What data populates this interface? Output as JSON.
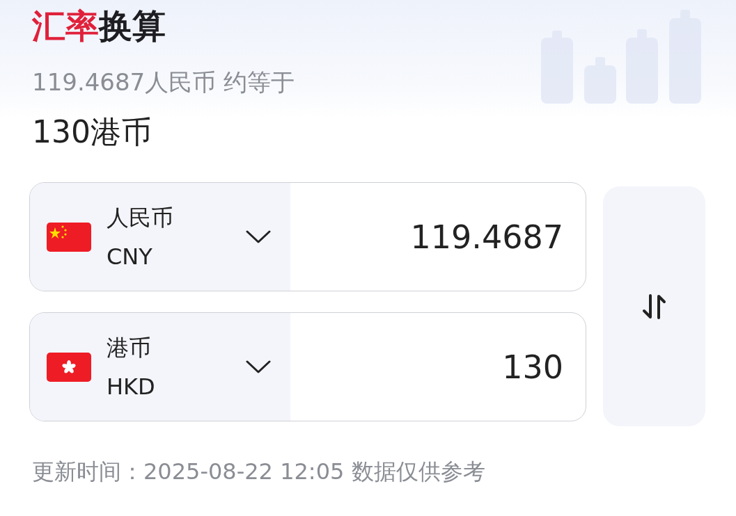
{
  "title": {
    "highlight": "汇率",
    "rest": "换算"
  },
  "summary": "119.4687人民币 约等于",
  "result": "130港币",
  "currencies": [
    {
      "kind": "cn",
      "name": "人民币",
      "code": "CNY",
      "amount": "119.4687"
    },
    {
      "kind": "hk",
      "name": "港币",
      "code": "HKD",
      "amount": "130"
    }
  ],
  "footer": "更新时间：2025-08-22 12:05 数据仅供参考"
}
